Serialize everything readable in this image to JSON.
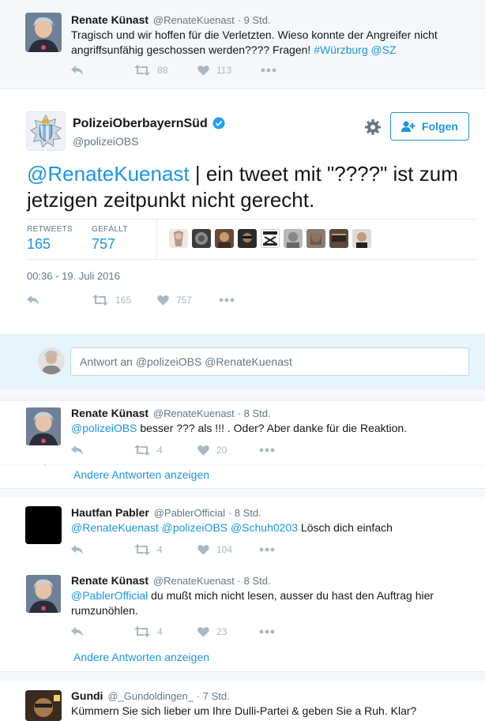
{
  "context_tweet": {
    "name": "Renate Künast",
    "handle": "@RenateKuenast",
    "time": "· 9 Std.",
    "text_plain": "Tragisch und wir hoffen für die Verletzten. Wieso konnte der Angreifer nicht angriffsunfähig geschossen werden???? Fragen! ",
    "hashtag": "#Würzburg",
    "mention": "@SZ",
    "retweets": "88",
    "likes": "113"
  },
  "main_tweet": {
    "name": "PolizeiOberbayernSüd",
    "handle": "@polizeiOBS",
    "follow_label": "Folgen",
    "mention": "@RenateKuenast",
    "text": " | ein tweet mit \"????\" ist zum jetzigen zeitpunkt nicht gerecht.",
    "retweets_label": "RETWEETS",
    "retweets": "165",
    "likes_label": "GEFÄLLT",
    "likes": "757",
    "timestamp": "00:36 - 19. Juli 2016",
    "action_retweets": "165",
    "action_likes": "757"
  },
  "reply_box": {
    "placeholder": "Antwort an @polizeiOBS @RenateKuenast"
  },
  "replies": [
    {
      "name": "Renate Künast",
      "handle": "@RenateKuenast",
      "time": "· 8 Std.",
      "mention": "@polizeiOBS",
      "text": " besser ??? als !!! . Oder?  Aber danke für die Reaktion.",
      "retweets": "4",
      "likes": "20"
    },
    {
      "name": "Hautfan Pabler",
      "handle": "@PablerOfficial",
      "time": "· 8 Std.",
      "mention": "@RenateKuenast @polizeiOBS @Schuh0203",
      "text": " Lösch dich einfach",
      "retweets": "4",
      "likes": "104"
    },
    {
      "name": "Renate Künast",
      "handle": "@RenateKuenast",
      "time": "· 8 Std.",
      "mention": "@PablerOfficial",
      "text": " du mußt mich nicht lesen, ausser du hast den Auftrag hier rumzunöhlen.",
      "retweets": "4",
      "likes": "23"
    },
    {
      "name": "Gundi",
      "handle": "@_Gundoldingen_",
      "time": "· 7 Std.",
      "text": "Kümmern Sie sich lieber um Ihre Dulli-Partei & geben Sie a Ruh. Klar?"
    }
  ],
  "show_more_1": "Andere Antworten anzeigen",
  "show_more_2": "Andere Antworten anzeigen",
  "colors": {
    "link": "#1b95e0",
    "icon_gray": "#aab8c2",
    "bg_gray": "#f5f8fa",
    "verified": "#1da1f2"
  }
}
